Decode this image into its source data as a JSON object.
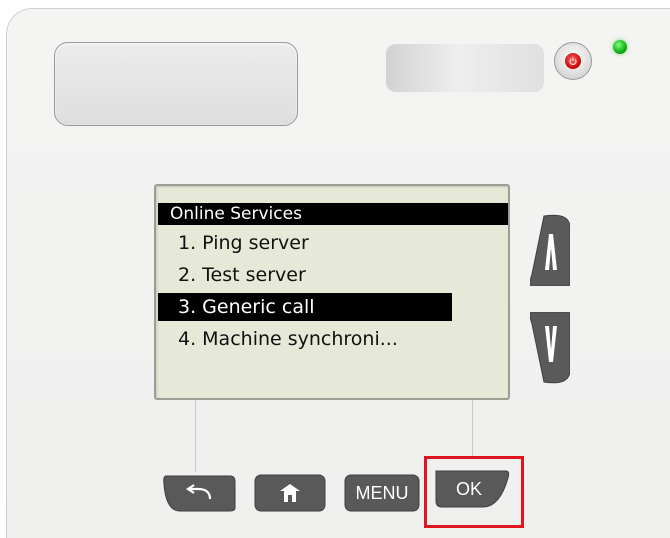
{
  "screen": {
    "title": "Online Services",
    "items": [
      {
        "label": "1. Ping server",
        "selected": false
      },
      {
        "label": "2. Test server",
        "selected": false
      },
      {
        "label": "3. Generic call",
        "selected": true
      },
      {
        "label": "4. Machine synchroni...",
        "selected": false
      }
    ]
  },
  "buttons": {
    "menu_label": "MENU",
    "ok_label": "OK"
  },
  "colors": {
    "highlight": "#e0161e",
    "led": "#18b318",
    "power": "#d00c0c",
    "lcd_background": "#e6e8d8"
  },
  "icons": {
    "back": "back-arrow-icon",
    "home": "home-icon",
    "up": "up-arrow-icon",
    "down": "down-arrow-icon",
    "power": "power-icon"
  }
}
